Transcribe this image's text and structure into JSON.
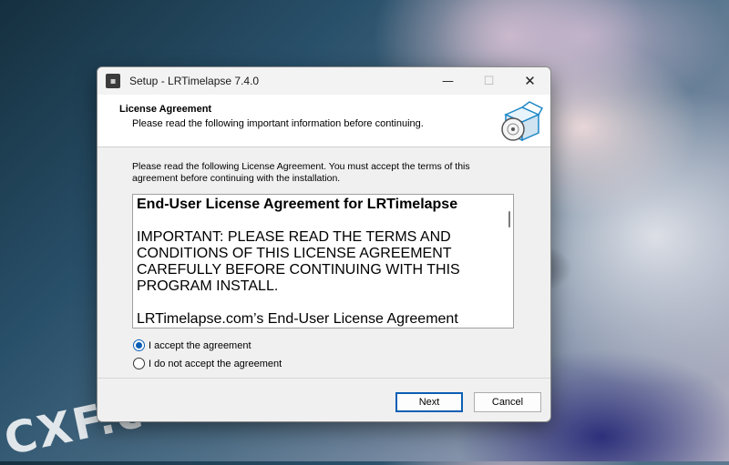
{
  "background": {
    "watermark": "CXF.c"
  },
  "window": {
    "title": "Setup - LRTimelapse 7.4.0",
    "controls": {
      "minimize": "—",
      "maximize": "☐",
      "close": "✕"
    }
  },
  "header": {
    "title": "License Agreement",
    "subtitle": "Please read the following important information before continuing.",
    "icon": "box-disc-icon"
  },
  "content": {
    "intro_line1": "Please read the following License Agreement. You must accept the terms of this",
    "intro_line2": "agreement before continuing with the installation.",
    "license": {
      "heading": "End-User License Agreement for LRTimelapse",
      "important_lines": [
        "IMPORTANT: PLEASE READ THE TERMS AND",
        "CONDITIONS OF THIS LICENSE AGREEMENT",
        "CAREFULLY BEFORE CONTINUING WITH THIS",
        "PROGRAM INSTALL."
      ],
      "last_line": "LRTimelapse.com’s End-User License Agreement"
    },
    "radios": [
      {
        "label": "I accept the agreement",
        "selected": true
      },
      {
        "label": "I do not accept the agreement",
        "selected": false
      }
    ]
  },
  "buttons": {
    "next": "Next",
    "cancel": "Cancel"
  },
  "colors": {
    "accent": "#0a5fb4",
    "dialog_bg": "#f0f0f0"
  }
}
